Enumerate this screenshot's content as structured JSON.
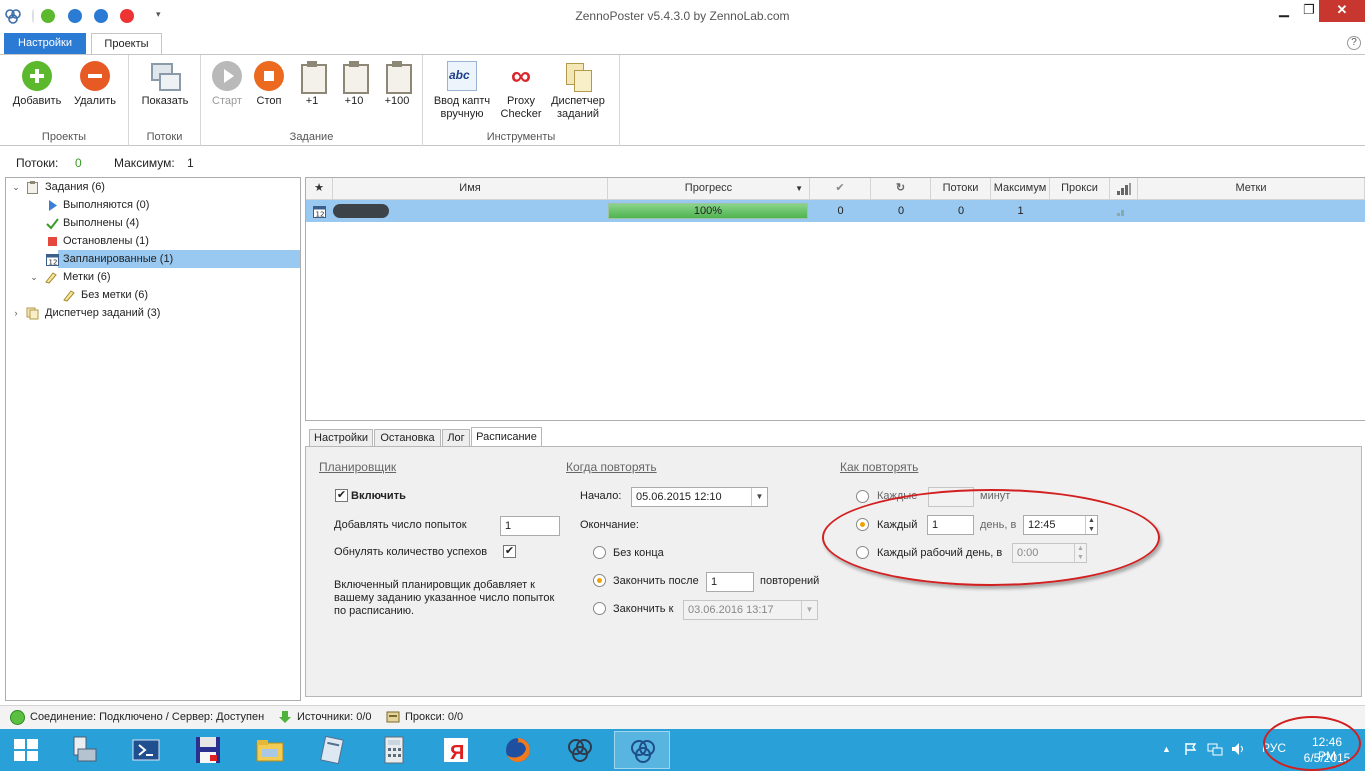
{
  "window": {
    "title": "ZennoPoster v5.4.3.0 by ZennoLab.com"
  },
  "main_tabs": [
    {
      "label": "Настройки"
    },
    {
      "label": "Проекты"
    }
  ],
  "help": "?",
  "ribbon": {
    "groups": [
      {
        "label": "Проекты",
        "buttons": [
          {
            "label": "Добавить",
            "icon": "plus-circle-icon"
          },
          {
            "label": "Удалить",
            "icon": "minus-circle-icon"
          }
        ]
      },
      {
        "label": "Потоки",
        "buttons": [
          {
            "label": "Показать",
            "icon": "windows-icon"
          }
        ]
      },
      {
        "label": "Задание",
        "buttons": [
          {
            "label": "Старт",
            "icon": "play-icon"
          },
          {
            "label": "Стоп",
            "icon": "stop-icon"
          },
          {
            "label": "+1",
            "icon": "clipboard-icon"
          },
          {
            "label": "+10",
            "icon": "clipboard-icon"
          },
          {
            "label": "+100",
            "icon": "clipboard-icon"
          }
        ]
      },
      {
        "label": "Инструменты",
        "buttons": [
          {
            "label": "Ввод каптч вручную",
            "icon": "captcha-icon"
          },
          {
            "label": "Proxy Checker",
            "icon": "infinity-icon"
          },
          {
            "label": "Диспетчер заданий",
            "icon": "task-dispatcher-icon"
          }
        ]
      }
    ]
  },
  "stats": {
    "threads_label": "Потоки:",
    "threads_value": "0",
    "max_label": "Максимум:",
    "max_value": "1"
  },
  "tree": [
    {
      "label": "Задания (6)",
      "icon": "clipboard-icon"
    },
    {
      "label": "Выполняются (0)",
      "icon": "play-triangle-icon"
    },
    {
      "label": "Выполнены (4)",
      "icon": "checkmark-icon"
    },
    {
      "label": "Остановлены (1)",
      "icon": "red-square-icon"
    },
    {
      "label": "Запланированные (1)",
      "icon": "calendar-icon"
    },
    {
      "label": "Метки (6)",
      "icon": "tag-icon"
    },
    {
      "label": "Без метки (6)",
      "icon": "tag-icon"
    },
    {
      "label": "Диспетчер заданий (3)",
      "icon": "task-dispatcher-icon"
    }
  ],
  "grid": {
    "columns": [
      "Имя",
      "Прогресс",
      "Потоки",
      "Максимум",
      "Прокси",
      "Метки"
    ],
    "header_icons": [
      "star-icon",
      "checkmark-icon",
      "refresh-icon",
      "signal-bars-icon"
    ],
    "rows": [
      {
        "progress_text": "100%",
        "progress": 1.0,
        "success": "0",
        "retries": "0",
        "threads": "0",
        "max": "1"
      }
    ]
  },
  "detail_tabs": [
    "Настройки",
    "Остановка",
    "Лог",
    "Расписание"
  ],
  "schedule": {
    "planner": {
      "title": "Планировщик",
      "enable_label": "Включить",
      "enabled": true,
      "add_attempts_label": "Добавлять число попыток",
      "add_attempts_value": "1",
      "reset_success_label": "Обнулять количество успехов",
      "reset_success": true,
      "description": "Включенный планировщик добавляет к вашему заданию указанное число попыток по расписанию."
    },
    "when": {
      "title": "Когда повторять",
      "start_label": "Начало:",
      "start_value": "05.06.2015 12:10",
      "end_label": "Окончание:",
      "no_end_label": "Без конца",
      "finish_after_label": "Закончить после",
      "finish_after_value": "1",
      "repeats_label": "повторений",
      "finish_at_label": "Закончить к",
      "finish_at_value": "03.06.2016 13:17",
      "selected": "finish_after"
    },
    "how": {
      "title": "Как повторять",
      "every_min_label": "Каждые",
      "every_min_value": "",
      "minutes_label": "минут",
      "every_day_label": "Каждый",
      "every_day_value": "1",
      "day_at_label": "день, в",
      "day_time_value": "12:45",
      "workday_label": "Каждый рабочий день, в",
      "workday_time_value": "0:00",
      "selected": "every_day"
    }
  },
  "statusbar": {
    "connection": "Соединение: Подключено / Сервер: Доступен",
    "sources": "Источники: 0/0",
    "proxies": "Прокси: 0/0"
  },
  "taskbar": {
    "apps": [
      "server-manager-icon",
      "powershell-icon",
      "save-icon",
      "file-explorer-icon",
      "notepad-icon",
      "calculator-icon",
      "yandex-browser-icon",
      "firefox-icon",
      "zennoposter-icon",
      "zennoposter-icon"
    ],
    "language": "РУС",
    "time": "12:46 PM",
    "date": "6/5/2015"
  },
  "colors": {
    "accent_blue": "#2b7bd4",
    "selection": "#99c9f0",
    "taskbar": "#2aa0d8",
    "highlight_red": "#d21f1f",
    "progress_green": "#4fb450"
  }
}
